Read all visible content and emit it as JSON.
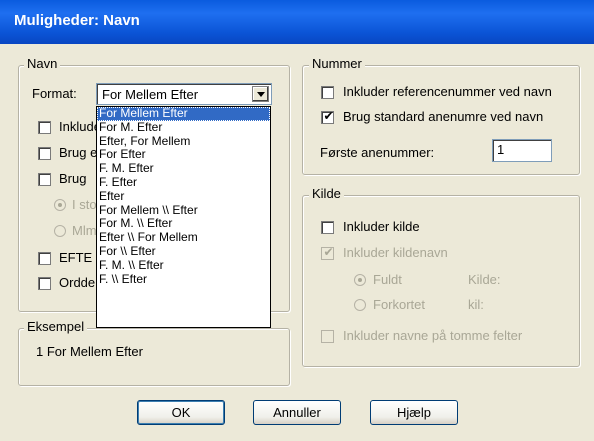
{
  "window": {
    "title": "Muligheder: Navn"
  },
  "navn_group": {
    "legend": "Navn",
    "format_label": "Format:",
    "format_value": "For Mellem Efter",
    "checkboxes": [
      "Inkluder",
      "Brug e",
      "Brug",
      "EFTE",
      "Ordde"
    ],
    "radios": [
      "I sto",
      "Mlm"
    ]
  },
  "dropdown": {
    "items": [
      "For Mellem Efter",
      "For M. Efter",
      "Efter, For Mellem",
      "For Efter",
      "F. M. Efter",
      "F. Efter",
      "Efter",
      "For Mellem \\\\ Efter",
      "For M. \\\\ Efter",
      "Efter \\\\ For Mellem",
      "For \\\\ Efter",
      "F. M. \\\\ Efter",
      "F. \\\\ Efter"
    ],
    "selected_index": 0
  },
  "eksempel": {
    "legend": "Eksempel",
    "text": "1 For Mellem Efter"
  },
  "nummer": {
    "legend": "Nummer",
    "inkluder_ref": {
      "label": "Inkluder referencenummer ved navn",
      "checked": false
    },
    "brug_standard": {
      "label": "Brug standard anenumre ved navn",
      "checked": true
    },
    "forste_label": "Første anenummer:",
    "forste_value": "1"
  },
  "kilde": {
    "legend": "Kilde",
    "inkluder_kilde": {
      "label": "Inkluder kilde",
      "checked": false
    },
    "inkluder_kildenavn": {
      "label": "Inkluder kildenavn",
      "checked": true,
      "disabled": true
    },
    "fuldt": {
      "label": "Fuldt",
      "side": "Kilde:"
    },
    "forkortet": {
      "label": "Forkortet",
      "side": "kil:"
    },
    "tomme": {
      "label": "Inkluder navne på tomme felter",
      "disabled": true
    }
  },
  "buttons": {
    "ok": "OK",
    "annuller": "Annuller",
    "hjaelp": "Hjælp"
  }
}
